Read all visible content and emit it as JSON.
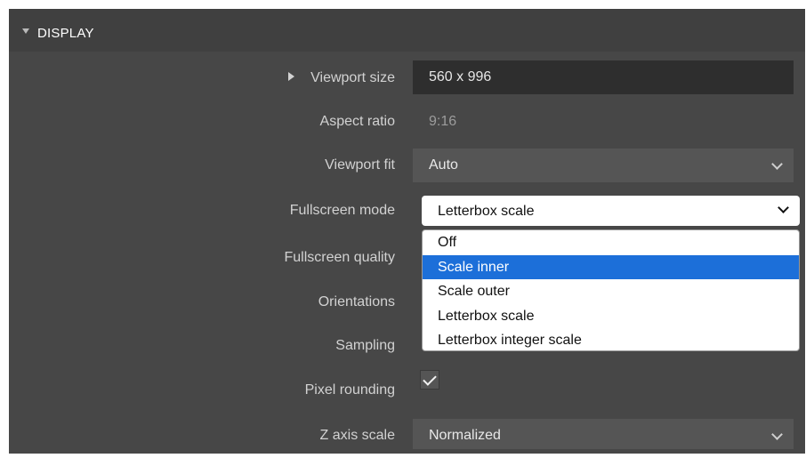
{
  "section": {
    "title": "DISPLAY"
  },
  "rows": {
    "viewport_size": {
      "label": "Viewport size",
      "value": "560 x 996"
    },
    "aspect_ratio": {
      "label": "Aspect ratio",
      "value": "9:16"
    },
    "viewport_fit": {
      "label": "Viewport fit",
      "value": "Auto"
    },
    "fullscreen_mode": {
      "label": "Fullscreen mode",
      "value": "Letterbox scale"
    },
    "fullscreen_quality": {
      "label": "Fullscreen quality"
    },
    "orientations": {
      "label": "Orientations"
    },
    "sampling": {
      "label": "Sampling"
    },
    "pixel_rounding": {
      "label": "Pixel rounding",
      "checked": true
    },
    "z_axis_scale": {
      "label": "Z axis scale",
      "value": "Normalized"
    }
  },
  "dropdown": {
    "options": [
      "Off",
      "Scale inner",
      "Scale outer",
      "Letterbox scale",
      "Letterbox integer scale"
    ],
    "highlighted": "Scale inner"
  },
  "colors": {
    "highlight": "#1c6fd9",
    "panel": "#474747",
    "header": "#404040"
  }
}
